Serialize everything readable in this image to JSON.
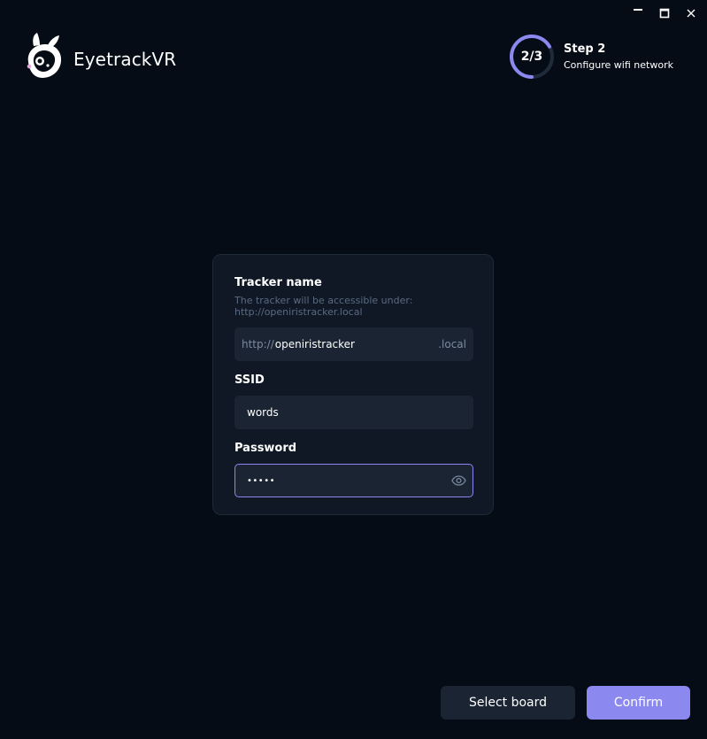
{
  "app": {
    "name": "EyetrackVR"
  },
  "window_controls": {
    "minimize_icon": "minimize-icon",
    "maximize_icon": "maximize-icon",
    "close_icon": "close-icon"
  },
  "step": {
    "count": "2/3",
    "progress": 0.6667,
    "title": "Step 2",
    "subtitle": "Configure wifi network"
  },
  "form": {
    "tracker_name": {
      "label": "Tracker name",
      "hint": "The tracker will be accessible under: http://openiristracker.local",
      "prefix": "http://",
      "value": "openiristracker",
      "suffix": ".local"
    },
    "ssid": {
      "label": "SSID",
      "value": "words"
    },
    "password": {
      "label": "Password",
      "value": "•••••",
      "toggle_icon": "eye-icon"
    }
  },
  "buttons": {
    "select_board": "Select board",
    "confirm": "Confirm"
  },
  "colors": {
    "background": "#050c16",
    "card": "#0f1824",
    "input": "#1a2433",
    "accent": "#8b88f0",
    "hint": "#5a6a82"
  }
}
